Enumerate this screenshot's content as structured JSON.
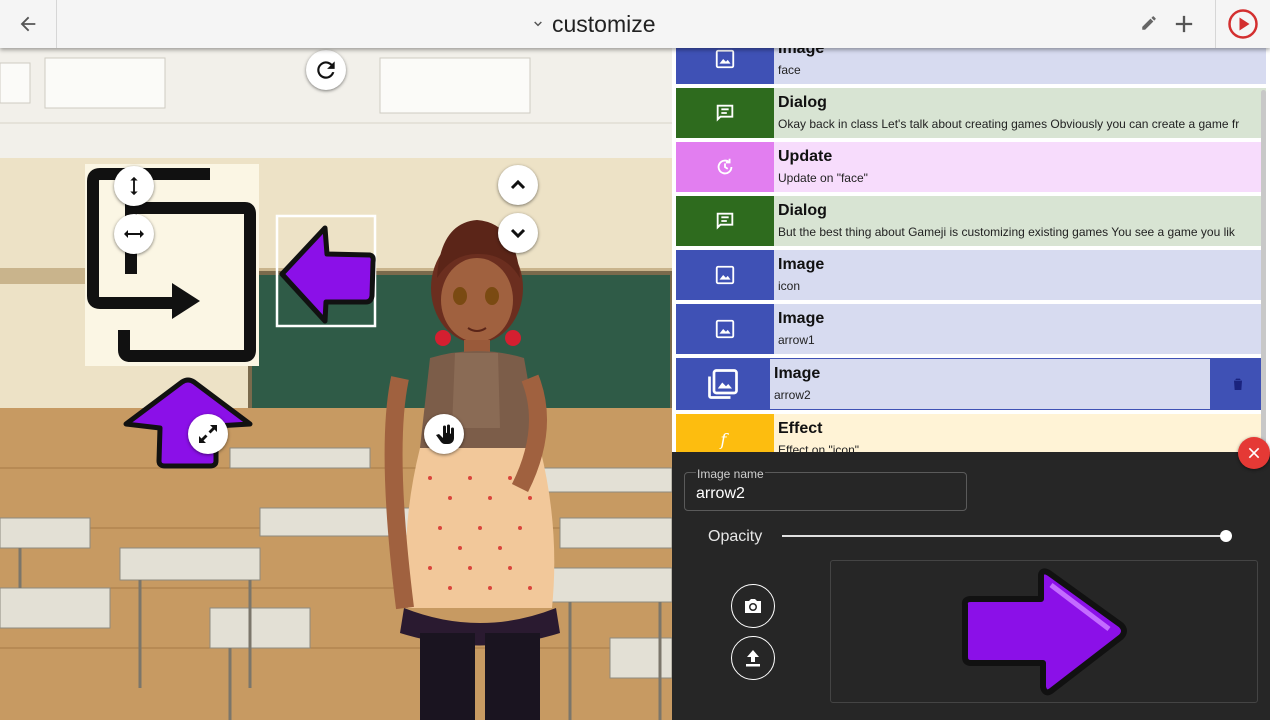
{
  "appbar": {
    "title": "customize",
    "back_icon": "arrow-back-icon",
    "dropdown_icon": "chevron-down-icon",
    "edit_icon": "pencil-icon",
    "add_icon": "plus-icon",
    "play_icon": "play-circle-icon"
  },
  "scene": {
    "reset_icon": "refresh-icon",
    "handles": [
      "resize-vertical-icon",
      "resize-horizontal-icon",
      "move-up-icon",
      "move-down-icon",
      "resize-diagonal-icon",
      "drag-hand-icon"
    ]
  },
  "events": [
    {
      "type": "Image",
      "desc": "face",
      "color": "#d7dbf0",
      "icon_bg": "#3f51b5",
      "icon": "image-icon"
    },
    {
      "type": "Dialog",
      "desc": "Okay back in class Let's talk about creating games Obviously you can create a game fr",
      "color": "#d8e4d3",
      "icon_bg": "#2e6b1e",
      "icon": "chat-icon"
    },
    {
      "type": "Update",
      "desc": "Update on \"face\"",
      "color": "#f7dcfc",
      "icon_bg": "#e27ef0",
      "icon": "update-icon"
    },
    {
      "type": "Dialog",
      "desc": "But the best thing about Gameji is customizing existing games You see a game you lik",
      "color": "#d8e4d3",
      "icon_bg": "#2e6b1e",
      "icon": "chat-icon"
    },
    {
      "type": "Image",
      "desc": "icon",
      "color": "#d7dbf0",
      "icon_bg": "#3f51b5",
      "icon": "image-icon"
    },
    {
      "type": "Image",
      "desc": "arrow1",
      "color": "#d7dbf0",
      "icon_bg": "#3f51b5",
      "icon": "image-icon"
    },
    {
      "type": "Image",
      "desc": "arrow2",
      "color": "#d7dbf0",
      "icon_bg": "#3f51b5",
      "icon": "image-multiple-icon",
      "selected": true
    },
    {
      "type": "Effect",
      "desc": "Effect on \"icon\"",
      "color": "#fff3d6",
      "icon_bg": "#fdbd0f",
      "icon": "function-icon"
    }
  ],
  "delete_icon": "trash-icon",
  "panel": {
    "image_name_label": "Image name",
    "image_name_value": "arrow2",
    "opacity_label": "Opacity",
    "opacity_value": 1.0,
    "camera_icon": "camera-icon",
    "upload_icon": "upload-icon",
    "close_icon": "close-icon"
  }
}
